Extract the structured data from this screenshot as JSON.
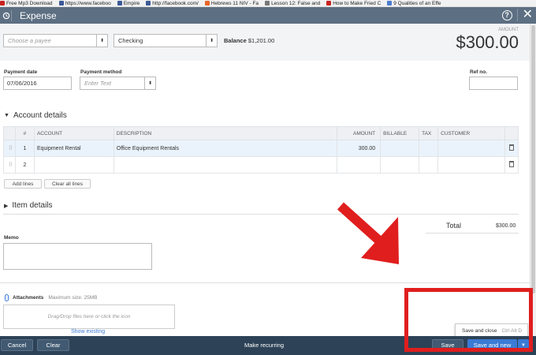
{
  "bookmarks": [
    {
      "label": "Free Mp3 Download",
      "color": "#c7221f"
    },
    {
      "label": "https://www.faceboo",
      "color": "#3b5998"
    },
    {
      "label": "Empire",
      "color": "#3b5998"
    },
    {
      "label": "http://facebook.com/",
      "color": "#3b5998"
    },
    {
      "label": "Hebrews 11 NIV - Fa",
      "color": "#e8652a"
    },
    {
      "label": "Lesson 12: False and",
      "color": "#777777"
    },
    {
      "label": "How to Make Fried C",
      "color": "#c7221f"
    },
    {
      "label": "9 Qualities of an Effe",
      "color": "#4b7bd0"
    }
  ],
  "header": {
    "title": "Expense",
    "help": "?",
    "close": "✕"
  },
  "payee": {
    "placeholder": "Choose a payee"
  },
  "account": {
    "value": "Checking"
  },
  "balance": {
    "label": "Balance",
    "value": "$1,201.00"
  },
  "amount": {
    "label": "AMOUNT",
    "value": "$300.00"
  },
  "payment_date": {
    "label": "Payment date",
    "value": "07/06/2016"
  },
  "payment_method": {
    "label": "Payment method",
    "placeholder": "Enter Text"
  },
  "ref": {
    "label": "Ref no."
  },
  "account_details": {
    "title": "Account details",
    "toggle": "▼"
  },
  "table": {
    "headers": [
      "#",
      "ACCOUNT",
      "DESCRIPTION",
      "AMOUNT",
      "BILLABLE",
      "TAX",
      "CUSTOMER"
    ],
    "rows": [
      {
        "num": "1",
        "account": "Equipment Rental",
        "description": "Office Equipment Rentals",
        "amount": "300.00"
      },
      {
        "num": "2",
        "account": "",
        "description": "",
        "amount": ""
      }
    ]
  },
  "buttons": {
    "add_lines": "Add lines",
    "clear_lines": "Clear all lines"
  },
  "item_details": {
    "title": "Item details",
    "toggle": "▶"
  },
  "total": {
    "label": "Total",
    "value": "$300.00"
  },
  "memo": {
    "label": "Memo"
  },
  "attachments": {
    "label": "Attachments",
    "max": "Maximum size: 25MB",
    "drop": "Drag/Drop files here or click the icon",
    "show_existing": "Show existing"
  },
  "popup": {
    "label": "Save and close",
    "shortcut": "Ctrl Alt D"
  },
  "footer": {
    "cancel": "Cancel",
    "clear": "Clear",
    "recurring": "Make recurring",
    "save": "Save",
    "save_new": "Save and new",
    "caret": "▼"
  },
  "colors": {
    "header": "#5d6f82",
    "footer": "#2d4256",
    "accent": "#3a7bd5",
    "annotation": "#e01e1e"
  }
}
